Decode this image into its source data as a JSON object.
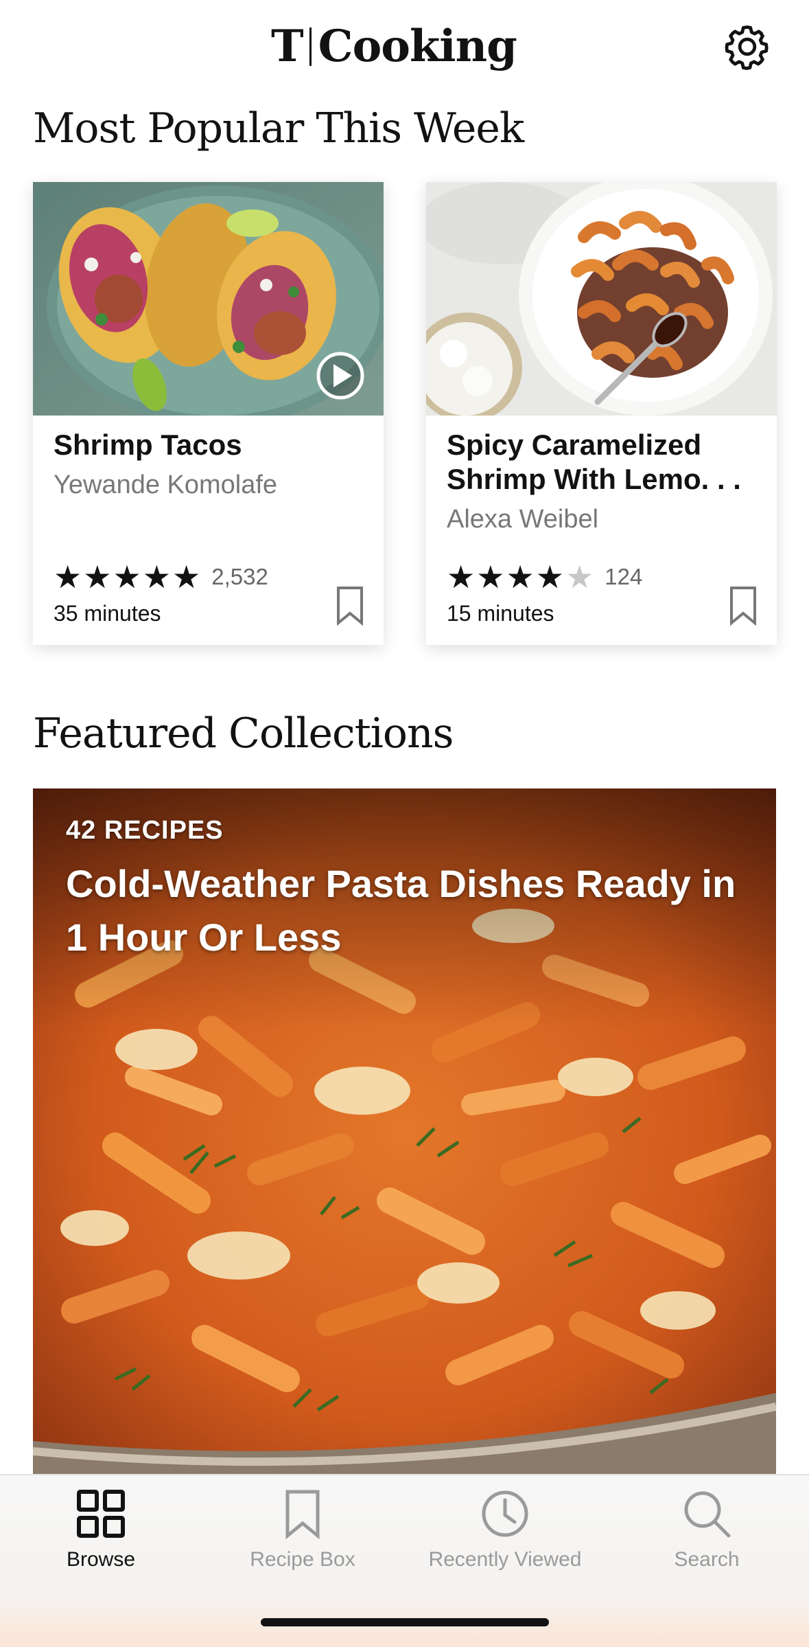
{
  "app": {
    "logo_mark": "T",
    "logo_word": "Cooking"
  },
  "popular": {
    "title": "Most Popular This Week",
    "cards": [
      {
        "title": "Shrimp Tacos",
        "author": "Yewande Komolafe",
        "rating": 5,
        "rating_count": "2,532",
        "time": "35 minutes",
        "has_video": true
      },
      {
        "title": "Spicy Caramelized Shrimp With Lemo. . .",
        "author": "Alexa Weibel",
        "rating": 4,
        "rating_count": "124",
        "time": "15 minutes",
        "has_video": false
      }
    ]
  },
  "featured": {
    "title": "Featured Collections",
    "collection": {
      "count": "42 RECIPES",
      "title": "Cold-Weather Pasta Dishes Ready in 1 Hour Or Less"
    }
  },
  "tabs": [
    {
      "label": "Browse",
      "icon": "grid-icon",
      "active": true
    },
    {
      "label": "Recipe Box",
      "icon": "bookmark-icon",
      "active": false
    },
    {
      "label": "Recently Viewed",
      "icon": "clock-icon",
      "active": false
    },
    {
      "label": "Search",
      "icon": "search-icon",
      "active": false
    }
  ],
  "colors": {
    "text": "#121212",
    "muted": "#777777",
    "inactive_tab": "#9a9a9a",
    "star_off": "#c7c7c7"
  }
}
